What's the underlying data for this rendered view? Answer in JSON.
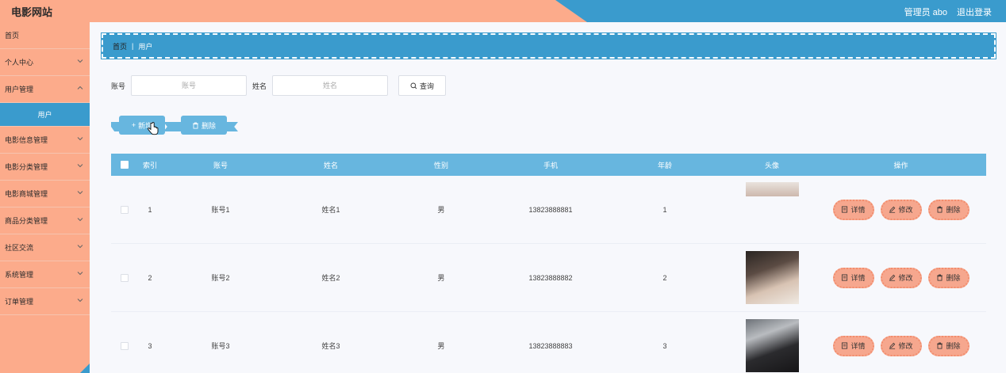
{
  "header": {
    "title": "电影网站",
    "user": "管理员 abo",
    "logout": "退出登录"
  },
  "colors": {
    "accent_blue": "#3a9bcd",
    "accent_orange": "#fcab8b",
    "table_head": "#67b6df"
  },
  "sidebar": {
    "items": [
      {
        "label": "首页"
      },
      {
        "label": "个人中心"
      },
      {
        "label": "用户管理"
      },
      {
        "label": "用户"
      },
      {
        "label": "电影信息管理"
      },
      {
        "label": "电影分类管理"
      },
      {
        "label": "电影商城管理"
      },
      {
        "label": "商品分类管理"
      },
      {
        "label": "社区交流"
      },
      {
        "label": "系统管理"
      },
      {
        "label": "订单管理"
      }
    ]
  },
  "breadcrumb": {
    "home": "首页",
    "current": "用户"
  },
  "search": {
    "account_label": "账号",
    "account_placeholder": "账号",
    "name_label": "姓名",
    "name_placeholder": "姓名",
    "query_button": "查询"
  },
  "actions": {
    "add": "新增",
    "delete": "删除"
  },
  "table": {
    "headers": {
      "index": "索引",
      "account": "账号",
      "name": "姓名",
      "sex": "性别",
      "phone": "手机",
      "age": "年龄",
      "avatar": "头像",
      "ops": "操作"
    },
    "rows": [
      {
        "index": "1",
        "account": "账号1",
        "name": "姓名1",
        "sex": "男",
        "phone": "13823888881",
        "age": "1"
      },
      {
        "index": "2",
        "account": "账号2",
        "name": "姓名2",
        "sex": "男",
        "phone": "13823888882",
        "age": "2"
      },
      {
        "index": "3",
        "account": "账号3",
        "name": "姓名3",
        "sex": "男",
        "phone": "13823888883",
        "age": "3"
      }
    ],
    "ops": {
      "detail": "详情",
      "edit": "修改",
      "delete": "删除"
    }
  }
}
